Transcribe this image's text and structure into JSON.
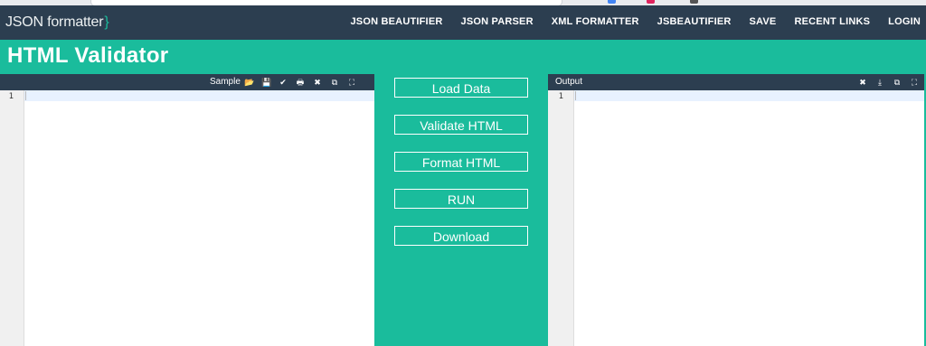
{
  "navbar": {
    "brand": "JSON formatter",
    "brand_brace": "}",
    "links": [
      "JSON BEAUTIFIER",
      "JSON PARSER",
      "XML FORMATTER",
      "JSBEAUTIFIER",
      "SAVE",
      "RECENT LINKS",
      "LOGIN"
    ]
  },
  "page": {
    "title": "HTML Validator"
  },
  "input_editor": {
    "title": "Sample",
    "tools": [
      {
        "name": "folder-open-icon",
        "glyph": "📂"
      },
      {
        "name": "save-icon",
        "glyph": "💾"
      },
      {
        "name": "check-icon",
        "glyph": "✔"
      },
      {
        "name": "print-icon",
        "glyph": "🖶"
      },
      {
        "name": "close-icon",
        "glyph": "✖"
      },
      {
        "name": "copy-icon",
        "glyph": "⧉"
      },
      {
        "name": "fullscreen-icon",
        "glyph": "⛶"
      }
    ],
    "line_number": "1"
  },
  "actions": {
    "load_data": "Load Data",
    "validate_html": "Validate HTML",
    "format_html": "Format HTML",
    "run": "RUN",
    "download": "Download"
  },
  "output_editor": {
    "title": "Output",
    "tools": [
      {
        "name": "close-icon",
        "glyph": "✖"
      },
      {
        "name": "download-icon",
        "glyph": "⤓"
      },
      {
        "name": "copy-icon",
        "glyph": "⧉"
      },
      {
        "name": "fullscreen-icon",
        "glyph": "⛶"
      }
    ],
    "line_number": "1"
  },
  "colors": {
    "primary": "#1abc9c",
    "navbar": "#2c3e50"
  }
}
